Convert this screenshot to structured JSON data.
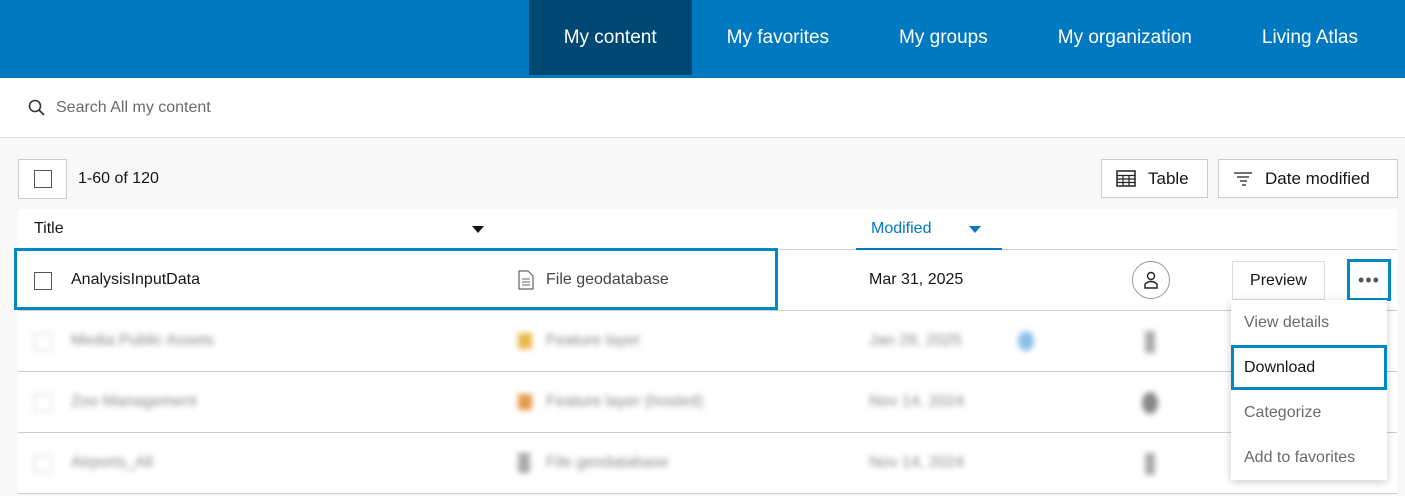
{
  "nav": {
    "tabs": [
      {
        "label": "My content",
        "active": true
      },
      {
        "label": "My favorites"
      },
      {
        "label": "My groups"
      },
      {
        "label": "My organization"
      },
      {
        "label": "Living Atlas"
      }
    ]
  },
  "search": {
    "placeholder": "Search All my content"
  },
  "toolbar": {
    "count": "1-60 of 120",
    "view_label": "Table",
    "sort_label": "Date modified"
  },
  "table": {
    "headers": {
      "title": "Title",
      "modified": "Modified"
    },
    "rows": [
      {
        "title": "AnalysisInputData",
        "type": "File geodatabase",
        "modified": "Mar 31, 2025",
        "preview": "Preview"
      },
      {
        "title": "Media Public Assets",
        "type": "Feature layer",
        "modified": "Jan 28, 2025"
      },
      {
        "title": "Zoo Management",
        "type": "Feature layer (hosted)",
        "modified": "Nov 14, 2024"
      },
      {
        "title": "Airports_All",
        "type": "File geodatabase",
        "modified": "Nov 14, 2024"
      }
    ]
  },
  "menu": {
    "items": [
      "View details",
      "Download",
      "Categorize",
      "Add to favorites"
    ]
  },
  "colors": {
    "brand": "#0079c1",
    "active_tab": "#004874",
    "focus": "#0088c2"
  }
}
